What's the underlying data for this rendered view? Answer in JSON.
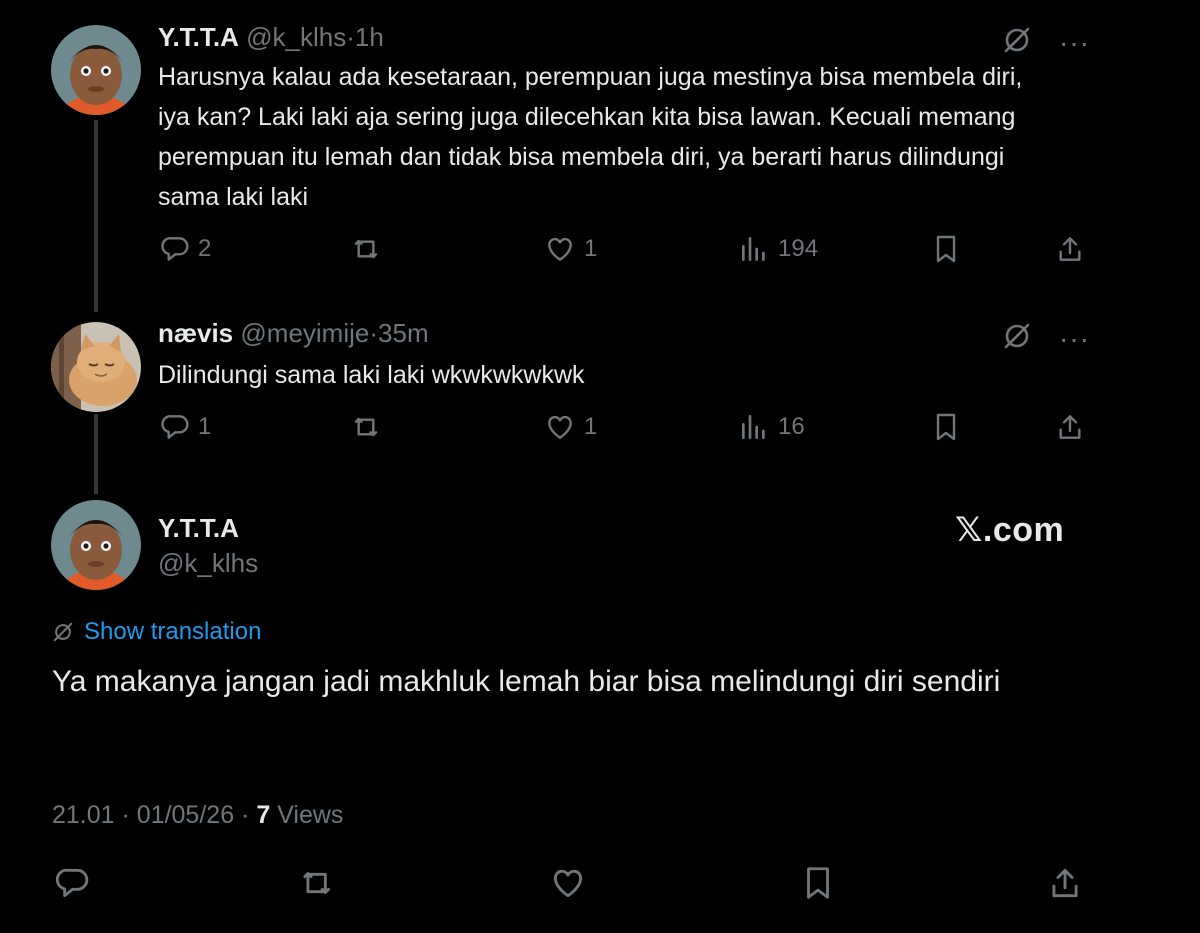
{
  "replies": [
    {
      "name": "Y.T.T.A",
      "handle": "@k_klhs",
      "separator": "·",
      "time": "1h",
      "text": "Harusnya kalau ada kesetaraan, perempuan juga mestinya bisa membela diri, iya kan? Laki laki aja sering juga dilecehkan kita bisa lawan. Kecuali memang perempuan itu lemah dan tidak bisa membela diri, ya berarti harus dilindungi sama laki laki",
      "replies": "2",
      "likes": "1",
      "views": "194",
      "more": "···"
    },
    {
      "name": "næviѕ",
      "handle": "@meyimije",
      "separator": "·",
      "time": "35m",
      "text": "Dilindungi sama laki laki wkwkwkwkwk",
      "replies": "1",
      "likes": "1",
      "views": "16",
      "more": "···"
    }
  ],
  "main_tweet": {
    "name": "Y.T.T.A",
    "handle": "@k_klhs",
    "watermark": "𝕏.com",
    "show_translation": "Show translation",
    "text": "Ya makanya jangan jadi makhluk lemah biar bisa melindungi diri sendiri",
    "timestamp": "21.01 · 01/05/26 ·",
    "views_count": "7",
    "views_label": "Views"
  },
  "colors": {
    "background": "#000000",
    "text": "#e7e9ea",
    "muted": "#71767b",
    "link": "#1d9bf0",
    "thread_line": "#333639"
  },
  "icons": [
    "reply-icon",
    "retweet-icon",
    "like-icon",
    "views-icon",
    "bookmark-icon",
    "share-icon",
    "grok-icon",
    "more-icon",
    "translate-icon"
  ]
}
